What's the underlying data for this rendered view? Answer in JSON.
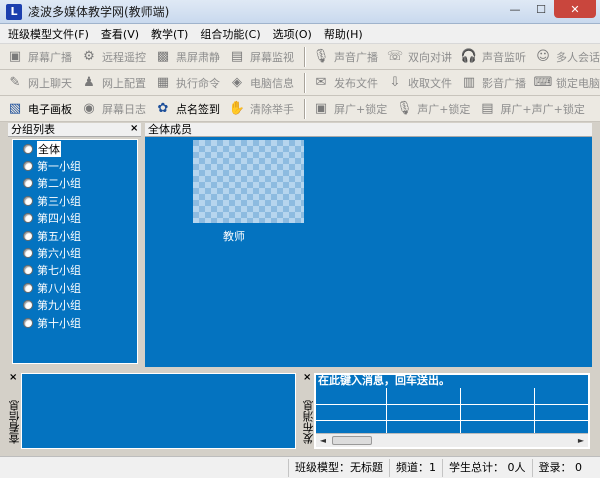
{
  "window": {
    "title": "凌波多媒体教学网(教师端)",
    "icon_label": "L",
    "min_label": "—",
    "max_label": "☐",
    "close_label": "✕"
  },
  "menu": [
    {
      "label": "班级模型文件(F)"
    },
    {
      "label": "查看(V)"
    },
    {
      "label": "教学(T)"
    },
    {
      "label": "组合功能(C)"
    },
    {
      "label": "选项(O)"
    },
    {
      "label": "帮助(H)"
    }
  ],
  "toolbar_row1": [
    {
      "label": "屏幕广播",
      "icon": "screen-broadcast-icon",
      "glyph": "▣"
    },
    {
      "label": "远程遥控",
      "icon": "remote-control-icon",
      "glyph": "⚙"
    },
    {
      "label": "黑屏肃静",
      "icon": "black-screen-icon",
      "glyph": "▩"
    },
    {
      "label": "屏幕监视",
      "icon": "screen-monitor-icon",
      "glyph": "▤"
    },
    {
      "label": "声音广播",
      "icon": "microphone-icon",
      "glyph": "🎙",
      "sep_before": true
    },
    {
      "label": "双向对讲",
      "icon": "intercom-icon",
      "glyph": "☏"
    },
    {
      "label": "声音监听",
      "icon": "headphones-icon",
      "glyph": "🎧"
    },
    {
      "label": "多人会话",
      "icon": "group-talk-icon",
      "glyph": "☺"
    }
  ],
  "toolbar_row2": [
    {
      "label": "网上聊天",
      "icon": "chat-icon",
      "glyph": "✎"
    },
    {
      "label": "网上配置",
      "icon": "network-config-icon",
      "glyph": "♟"
    },
    {
      "label": "执行命令",
      "icon": "execute-command-icon",
      "glyph": "▦"
    },
    {
      "label": "电脑信息",
      "icon": "computer-info-icon",
      "glyph": "◈"
    },
    {
      "label": "发布文件",
      "icon": "publish-file-icon",
      "glyph": "✉",
      "sep_before": true
    },
    {
      "label": "收取文件",
      "icon": "collect-file-icon",
      "glyph": "⇩"
    },
    {
      "label": "影音广播",
      "icon": "video-broadcast-icon",
      "glyph": "▥"
    },
    {
      "label": "锁定电脑",
      "icon": "lock-computer-icon",
      "glyph": "⌨"
    }
  ],
  "toolbar_row3": [
    {
      "label": "电子画板",
      "icon": "whiteboard-icon",
      "glyph": "▧",
      "active": true
    },
    {
      "label": "屏幕日志",
      "icon": "screen-log-icon",
      "glyph": "◉"
    },
    {
      "label": "点名签到",
      "icon": "roll-call-icon",
      "glyph": "✿",
      "active": true
    },
    {
      "label": "清除举手",
      "icon": "clear-raise-hand-icon",
      "glyph": "✋"
    },
    {
      "label": "屏广+锁定",
      "icon": "broadcast-lock-icon",
      "glyph": "▣",
      "sep_before": true
    },
    {
      "label": "声广+锁定",
      "icon": "sound-lock-icon",
      "glyph": "🎙"
    },
    {
      "label": "屏广+声广+锁定",
      "icon": "screen-sound-lock-icon",
      "glyph": "▤"
    }
  ],
  "group_panel": {
    "title": "分组列表",
    "close": "×",
    "items": [
      "全体",
      "第一小组",
      "第二小组",
      "第三小组",
      "第四小组",
      "第五小组",
      "第六小组",
      "第七小组",
      "第八小组",
      "第九小组",
      "第十小组"
    ],
    "selected_index": 0
  },
  "members_panel": {
    "title": "全体成员",
    "teacher_label": "教师"
  },
  "bottom_left": {
    "close": "×",
    "vertical_label": "查看信息"
  },
  "bottom_right": {
    "close": "×",
    "vertical_label": "发布消息",
    "input_value": "在此键入消息，回车送出。",
    "scroll_left": "◄",
    "scroll_right": "►"
  },
  "status": {
    "model": "班级模型：无标题",
    "channel": "频道：1",
    "students": "学生总计：  0人",
    "login": "登录：  0"
  },
  "colors": {
    "pane_blue": "#0473c0",
    "chrome": "#d4d0c8"
  }
}
